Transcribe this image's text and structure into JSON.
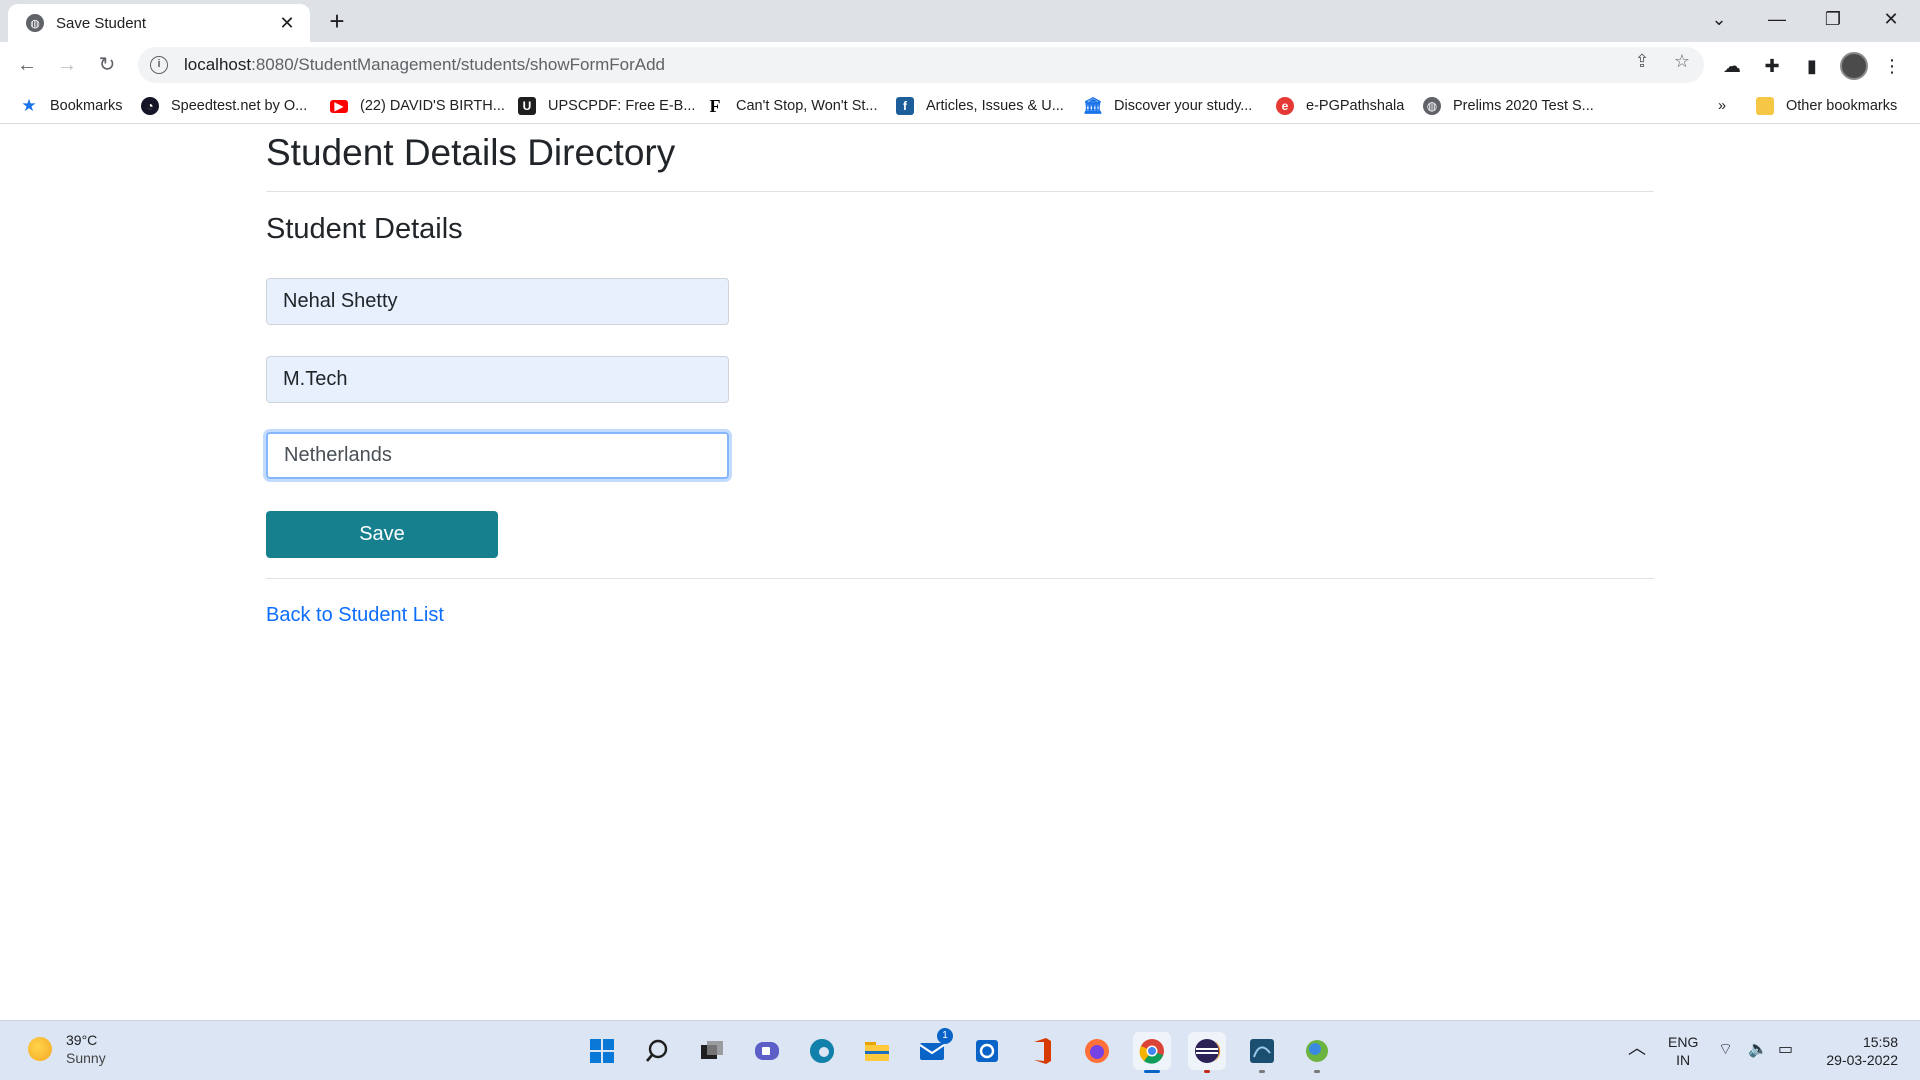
{
  "browser": {
    "tab_title": "Save Student",
    "url_host": "localhost",
    "url_rest": ":8080/StudentManagement/students/showFormForAdd",
    "bookmarks": [
      {
        "label": "Bookmarks",
        "icon": "star-icon",
        "color": "#1a73e8"
      },
      {
        "label": "Speedtest.net by O...",
        "icon": "speedtest-icon",
        "color": "#141526"
      },
      {
        "label": "(22) DAVID'S BIRTH...",
        "icon": "youtube-icon",
        "color": "#ff0000"
      },
      {
        "label": "UPSCPDF: Free E-B...",
        "icon": "upscpdf-icon",
        "color": "#1e1e1e"
      },
      {
        "label": "Can't Stop, Won't St...",
        "icon": "forbes-f-icon",
        "color": "#000000"
      },
      {
        "label": "Articles, Issues & U...",
        "icon": "articles-icon",
        "color": "#1b5e9a"
      },
      {
        "label": "Discover your study...",
        "icon": "institution-icon",
        "color": "#1a73e8"
      },
      {
        "label": "e-PGPathshala",
        "icon": "epg-icon",
        "color": "#e53935"
      },
      {
        "label": "Prelims 2020 Test S...",
        "icon": "globe-icon",
        "color": "#5f6368"
      }
    ],
    "overflow_label": "»",
    "other_bookmarks": "Other bookmarks"
  },
  "page": {
    "title": "Student Details Directory",
    "form_title": "Student Details",
    "fields": {
      "first_name": "Nehal Shetty",
      "course": "M.Tech",
      "country": "Netherlands"
    },
    "save_label": "Save",
    "back_link": "Back to Student List"
  },
  "taskbar": {
    "weather_temp": "39°C",
    "weather_cond": "Sunny",
    "lang_top": "ENG",
    "lang_bottom": "IN",
    "time": "15:58",
    "date": "29-03-2022",
    "mail_badge": "1"
  },
  "colors": {
    "accent_button": "#17808f",
    "link": "#0d6efd",
    "autofill_bg": "#e8f0fe"
  }
}
